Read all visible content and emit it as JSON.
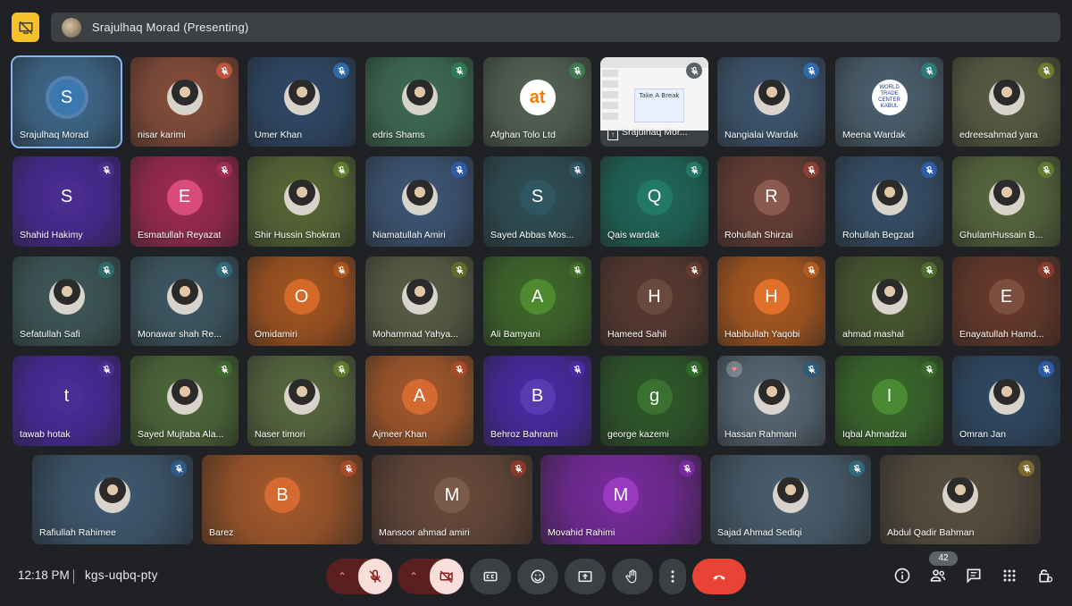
{
  "presenting": {
    "title": "Srajulhaq Morad (Presenting)"
  },
  "colors": {
    "accent_blue": "#8ab4f8",
    "hangup": "#ea4335",
    "presenting_icon": "#f6c12a"
  },
  "participants": [
    {
      "name": "Srajulhaq Morad",
      "initial": "S",
      "bg": "#3f6b8f",
      "avbg": "#3b78b0",
      "mic": "none",
      "active": true
    },
    {
      "name": "nisar karimi",
      "initial": "",
      "bg": "#8b4f3b",
      "avbg": "photo",
      "mic": "#c0533b"
    },
    {
      "name": "Umer Khan",
      "initial": "",
      "bg": "#2f4a6a",
      "avbg": "photo",
      "mic": "#2e6aa8"
    },
    {
      "name": "edris Shams",
      "initial": "",
      "bg": "#3f6e57",
      "avbg": "photo",
      "mic": "#2f7a55"
    },
    {
      "name": "Afghan Tolo Ltd",
      "initial": "at",
      "bg": "#556456",
      "avbg": "logo-at",
      "mic": "#3f7a50"
    },
    {
      "name": "Srajulhaq Mor...",
      "initial": "",
      "bg": "#555",
      "avbg": "slide",
      "mic": "muted-grey"
    },
    {
      "name": "Nangialai Wardak",
      "initial": "",
      "bg": "#3f5872",
      "avbg": "photo",
      "mic": "#2e6aa8"
    },
    {
      "name": "Meena Wardak",
      "initial": "WORLD TRADE CENTER KABUL",
      "bg": "#4d6270",
      "avbg": "logo-wtc",
      "mic": "#2e7a78"
    },
    {
      "name": "edreesahmad yara",
      "initial": "",
      "bg": "#5b5f44",
      "avbg": "photo",
      "mic": "#6f7a2e"
    },
    {
      "name": "Shahid Hakimy",
      "initial": "S",
      "bg": "#4b2a9a",
      "avbg": "#4a2d8c",
      "mic": "#4a2d8c"
    },
    {
      "name": "Esmatullah Reyazat",
      "initial": "E",
      "bg": "#a32a52",
      "avbg": "#d94b7a",
      "mic": "#a32a52"
    },
    {
      "name": "Shir Hussin Shokran",
      "initial": "",
      "bg": "#5a6a36",
      "avbg": "photo",
      "mic": "#5f7a2e"
    },
    {
      "name": "Niamatullah Amiri",
      "initial": "",
      "bg": "#3e5778",
      "avbg": "photo",
      "mic": "#2e5aa8"
    },
    {
      "name": "Sayed Abbas Mos...",
      "initial": "S",
      "bg": "#2f4f56",
      "avbg": "#2f5560",
      "mic": "#2f5560"
    },
    {
      "name": "Qais wardak",
      "initial": "Q",
      "bg": "#1f6a5a",
      "avbg": "#227a66",
      "mic": "#227a66"
    },
    {
      "name": "Rohullah Shirzai",
      "initial": "R",
      "bg": "#6a3f35",
      "avbg": "#8a5a4f",
      "mic": "#8a3f35"
    },
    {
      "name": "Rohullah Begzad",
      "initial": "",
      "bg": "#36506a",
      "avbg": "photo",
      "mic": "#2e5aa8"
    },
    {
      "name": "GhulamHussain B...",
      "initial": "",
      "bg": "#5a6a3f",
      "avbg": "photo",
      "mic": "#5f7a2e"
    },
    {
      "name": "Sefatullah Safi",
      "initial": "",
      "bg": "#3f5a5a",
      "avbg": "photo",
      "mic": "#2e6a6a"
    },
    {
      "name": "Monawar shah Re...",
      "initial": "",
      "bg": "#3f5a66",
      "avbg": "photo",
      "mic": "#2e6a78"
    },
    {
      "name": "Omidamiri",
      "initial": "O",
      "bg": "#a8561f",
      "avbg": "#d4692a",
      "mic": "#a8561f"
    },
    {
      "name": "Mohammad Yahya...",
      "initial": "",
      "bg": "#5a6046",
      "avbg": "photo",
      "mic": "#5f6a2e"
    },
    {
      "name": "Ali Bamyani",
      "initial": "A",
      "bg": "#3f6a2a",
      "avbg": "#4f8a30",
      "mic": "#3f6a2a"
    },
    {
      "name": "Hameed Sahil",
      "initial": "H",
      "bg": "#5a3a30",
      "avbg": "#6a4a3f",
      "mic": "#6a3a30"
    },
    {
      "name": "Habibullah Yaqobi",
      "initial": "H",
      "bg": "#b05a1f",
      "avbg": "#e0702a",
      "mic": "#b05a1f"
    },
    {
      "name": "ahmad mashal",
      "initial": "",
      "bg": "#4a5a30",
      "avbg": "photo",
      "mic": "#4f6a2e"
    },
    {
      "name": "Enayatullah Hamd...",
      "initial": "E",
      "bg": "#6a3a2a",
      "avbg": "#7a4f3f",
      "mic": "#8a3a2a"
    },
    {
      "name": "tawab hotak",
      "initial": "t",
      "bg": "#4b2aa0",
      "avbg": "#4a2d95",
      "mic": "#4a2d95"
    },
    {
      "name": "Sayed Mujtaba Ala...",
      "initial": "",
      "bg": "#4f6a3a",
      "avbg": "photo",
      "mic": "#3f6a2e"
    },
    {
      "name": "Naser timori",
      "initial": "",
      "bg": "#5a6a40",
      "avbg": "photo",
      "mic": "#5f7a2e"
    },
    {
      "name": "Ajmeer Khan",
      "initial": "A",
      "bg": "#a85a2a",
      "avbg": "#d46a30",
      "mic": "#a84a2a"
    },
    {
      "name": "Behroz Bahrami",
      "initial": "B",
      "bg": "#4a2aa8",
      "avbg": "#5a3ab0",
      "mic": "#4a2aa8"
    },
    {
      "name": "george kazemi",
      "initial": "g",
      "bg": "#2f5a2a",
      "avbg": "#3a7030",
      "mic": "#2f6a2a"
    },
    {
      "name": "Hassan Rahmani",
      "initial": "",
      "bg": "#5a6a78",
      "avbg": "photo",
      "mic": "#2e5a78",
      "heart": true
    },
    {
      "name": "Iqbal Ahmadzai",
      "initial": "I",
      "bg": "#3a6a2a",
      "avbg": "#4a8a35",
      "mic": "#3a6a2a"
    },
    {
      "name": "Omran Jan",
      "initial": "",
      "bg": "#2f4a66",
      "avbg": "photo",
      "mic": "#2e5aa8"
    },
    {
      "name": "Rafiullah Rahimee",
      "initial": "",
      "bg": "#3f5a72",
      "avbg": "photo",
      "mic": "#2e5a88"
    },
    {
      "name": "Barez",
      "initial": "B",
      "bg": "#a85a2a",
      "avbg": "#d46a30",
      "mic": "#a84a2a"
    },
    {
      "name": "Mansoor ahmad amiri",
      "initial": "M",
      "bg": "#6a4a3a",
      "avbg": "#7a5a4a",
      "mic": "#8a3a2a"
    },
    {
      "name": "Movahid Rahimi",
      "initial": "M",
      "bg": "#7a2aa0",
      "avbg": "#9a3ac0",
      "mic": "#7a2aa0"
    },
    {
      "name": "Sajad Ahmad Sediqi",
      "initial": "",
      "bg": "#4a6070",
      "avbg": "photo",
      "mic": "#2e6a78"
    },
    {
      "name": "Abdul Qadir Bahman",
      "initial": "",
      "bg": "#5a5040",
      "avbg": "photo",
      "mic": "#7a6a2e"
    }
  ],
  "slide": {
    "text": "Take A Break"
  },
  "bottom": {
    "time": "12:18 PM",
    "meeting_code": "kgs-uqbq-pty",
    "participants_count": "42"
  },
  "icons": [
    "presentation-icon",
    "mic-off-icon",
    "camera-off-icon",
    "captions-icon",
    "emoji-icon",
    "present-screen-icon",
    "raise-hand-icon",
    "more-options-icon",
    "hangup-icon",
    "info-icon",
    "people-icon",
    "chat-icon",
    "activities-icon",
    "host-controls-icon"
  ]
}
